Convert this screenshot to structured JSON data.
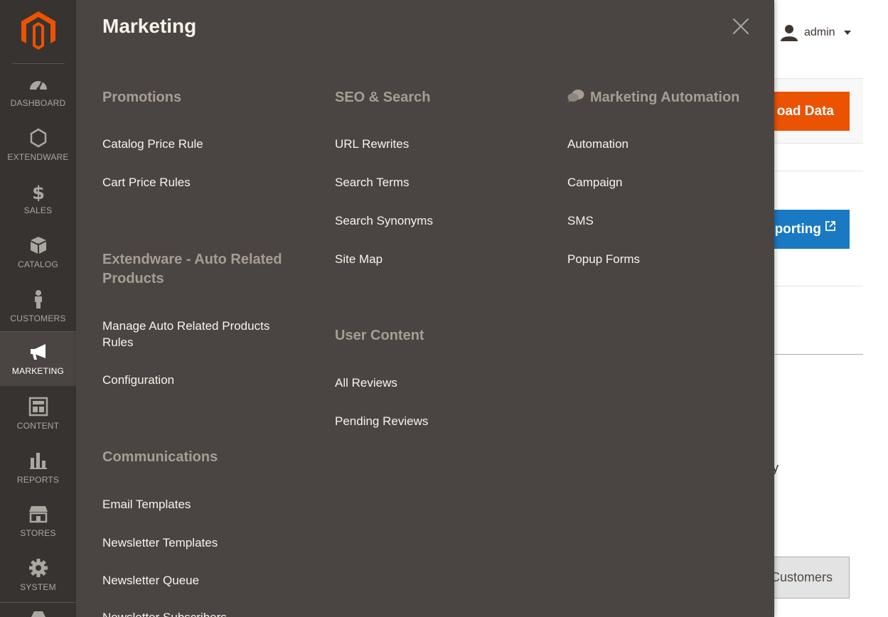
{
  "nav": {
    "items": [
      {
        "id": "dashboard",
        "label": "DASHBOARD",
        "icon": "dashboard-icon"
      },
      {
        "id": "extendware",
        "label": "EXTENDWARE",
        "icon": "hexagon-icon"
      },
      {
        "id": "sales",
        "label": "SALES",
        "icon": "dollar-icon"
      },
      {
        "id": "catalog",
        "label": "CATALOG",
        "icon": "cube-icon"
      },
      {
        "id": "customers",
        "label": "CUSTOMERS",
        "icon": "person-icon"
      },
      {
        "id": "marketing",
        "label": "MARKETING",
        "icon": "megaphone-icon",
        "active": true
      },
      {
        "id": "content",
        "label": "CONTENT",
        "icon": "layout-icon"
      },
      {
        "id": "reports",
        "label": "REPORTS",
        "icon": "bar-chart-icon"
      },
      {
        "id": "stores",
        "label": "STORES",
        "icon": "store-icon"
      },
      {
        "id": "system",
        "label": "SYSTEM",
        "icon": "gear-icon"
      }
    ]
  },
  "header": {
    "user": "admin"
  },
  "background": {
    "orange_button": "oad Data",
    "blue_button": "porting",
    "partial_char": "y",
    "grey_button": "Customers"
  },
  "panel": {
    "title": "Marketing",
    "columns": [
      {
        "sections": [
          {
            "title": "Promotions",
            "links": [
              "Catalog Price Rule",
              "Cart Price Rules"
            ]
          },
          {
            "title": "Extendware - Auto Related Products",
            "links": [
              "Manage Auto Related Products Rules",
              "Configuration"
            ]
          },
          {
            "title": "Communications",
            "links": [
              "Email Templates",
              "Newsletter Templates",
              "Newsletter Queue",
              "Newsletter Subscribers"
            ]
          }
        ]
      },
      {
        "sections": [
          {
            "title": "SEO & Search",
            "links": [
              "URL Rewrites",
              "Search Terms",
              "Search Synonyms",
              "Site Map"
            ]
          },
          {
            "title": "User Content",
            "links": [
              "All Reviews",
              "Pending Reviews"
            ]
          }
        ]
      },
      {
        "sections": [
          {
            "title": "Marketing Automation",
            "icon": "chat-bubbles-icon",
            "links": [
              "Automation",
              "Campaign",
              "SMS",
              "Popup Forms"
            ]
          }
        ]
      }
    ]
  },
  "colors": {
    "nav_bg": "#373330",
    "panel_bg": "#4a4542",
    "section_title": "#a79d95",
    "link": "#f7f3eb",
    "brand_orange": "#eb5202",
    "blue": "#1979c3"
  }
}
